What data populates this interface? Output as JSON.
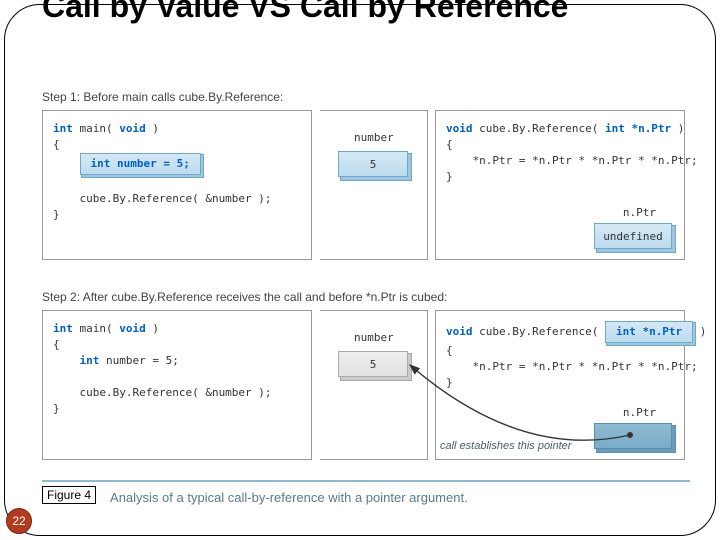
{
  "title": "Call by Value VS Call by Reference",
  "step1": {
    "label": "Step 1: Before main calls cube.By.Reference:",
    "main_sig_pre": "int",
    "main_sig_name": " main( ",
    "main_sig_void": "void",
    "main_sig_post": " )",
    "brace_open": "{",
    "decl_box": "int number = 5;",
    "call_line": "    cube.By.Reference( &number );",
    "brace_close": "}",
    "mid_var": "number",
    "mid_val": "5",
    "func_sig_pre": "void",
    "func_sig_name": " cube.By.Reference( ",
    "func_sig_arg": "int *n.Ptr",
    "func_sig_post": " )",
    "body_line": "    *n.Ptr = *n.Ptr * *n.Ptr * *n.Ptr;",
    "ptr_label": "n.Ptr",
    "ptr_val": "undefined"
  },
  "step2": {
    "label": "Step 2: After cube.By.Reference receives the call and before *n.Ptr is cubed:",
    "main_sig_pre": "int",
    "main_sig_name": " main( ",
    "main_sig_void": "void",
    "main_sig_post": " )",
    "brace_open": "{",
    "decl_line_kw": "    int",
    "decl_line_rest": " number = 5;",
    "call_line": "    cube.By.Reference( &number );",
    "brace_close": "}",
    "mid_var": "number",
    "mid_val": "5",
    "func_sig_pre": "void",
    "func_sig_name": " cube.By.Reference( ",
    "func_sig_arg": "int *n.Ptr",
    "func_sig_post": " )",
    "body_line": "    *n.Ptr = *n.Ptr * *n.Ptr * *n.Ptr;",
    "ptr_label": "n.Ptr",
    "pointer_note": "call establishes this pointer"
  },
  "figure_label": "Figure 4",
  "caption": "Analysis of a typical call-by-reference with a pointer argument.",
  "page_number": "22"
}
